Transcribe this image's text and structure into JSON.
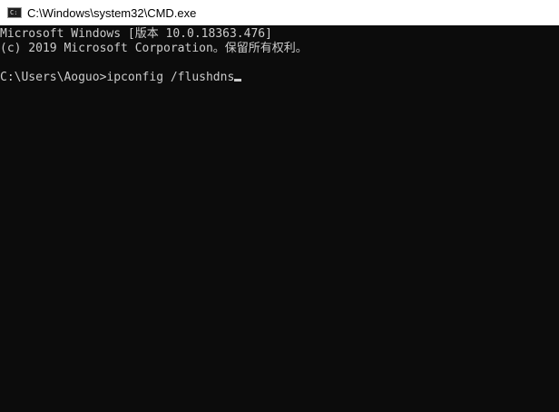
{
  "window": {
    "title": "C:\\Windows\\system32\\CMD.exe",
    "icon": "console-icon"
  },
  "console": {
    "lines": [
      "Microsoft Windows [版本 10.0.18363.476]",
      "(c) 2019 Microsoft Corporation。保留所有权利。",
      "",
      "C:\\Users\\Aoguo>ipconfig /flushdns"
    ],
    "prompt": "C:\\Users\\Aoguo>",
    "command": "ipconfig /flushdns"
  },
  "colors": {
    "console_background": "#0c0c0c",
    "console_text": "#cccccc",
    "titlebar_background": "#ffffff"
  }
}
